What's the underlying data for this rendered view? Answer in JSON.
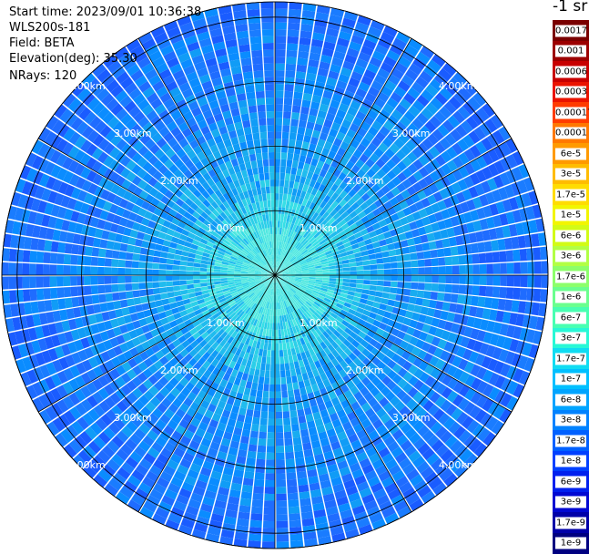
{
  "header": {
    "start_time": "Start time: 2023/09/01 10:36:38",
    "instrument": "WLS200s-181",
    "field": "Field: BETA",
    "elevation": "Elevation(deg): 35.30",
    "nrays": "NRays: 120"
  },
  "colorbar": {
    "title": "-1 sr",
    "labels": [
      "0.0017",
      "0.001",
      "0.0006",
      "0.0003",
      "0.00017",
      "0.0001",
      "6e-5",
      "3e-5",
      "1.7e-5",
      "1e-5",
      "6e-6",
      "3e-6",
      "1.7e-6",
      "1e-6",
      "6e-7",
      "3e-7",
      "1.7e-7",
      "1e-7",
      "6e-8",
      "3e-8",
      "1.7e-8",
      "1e-8",
      "6e-9",
      "3e-9",
      "1.7e-9",
      "1e-9"
    ],
    "colors": [
      "#7a0000",
      "#9c0000",
      "#c80000",
      "#ea1400",
      "#ff3c00",
      "#ff7800",
      "#ff9a00",
      "#ffbc00",
      "#ffdc00",
      "#f2f500",
      "#d2fb16",
      "#b2ff44",
      "#8cff6a",
      "#6aff8e",
      "#48ffb2",
      "#28f8d6",
      "#10dcf2",
      "#00c0ff",
      "#00a4ff",
      "#0082ff",
      "#0060ff",
      "#0040ff",
      "#0020ee",
      "#0008d2",
      "#0000a8",
      "#000080"
    ]
  },
  "chart_data": {
    "type": "heatmap",
    "projection": "polar PPI scan",
    "n_rays": 120,
    "range_rings_km": [
      1,
      2,
      3,
      4,
      5
    ],
    "ring_labels": [
      "1.00km",
      "2.00km",
      "3.00km",
      "4.00km",
      "5.00km"
    ],
    "radial_lines_deg": [
      0,
      30,
      60,
      90,
      120,
      150,
      180,
      210,
      240,
      270,
      300,
      330
    ],
    "max_range_km": 5,
    "dominant_value_range": [
      1e-08,
      1e-07
    ],
    "near_range_value": 1.7e-07
  }
}
